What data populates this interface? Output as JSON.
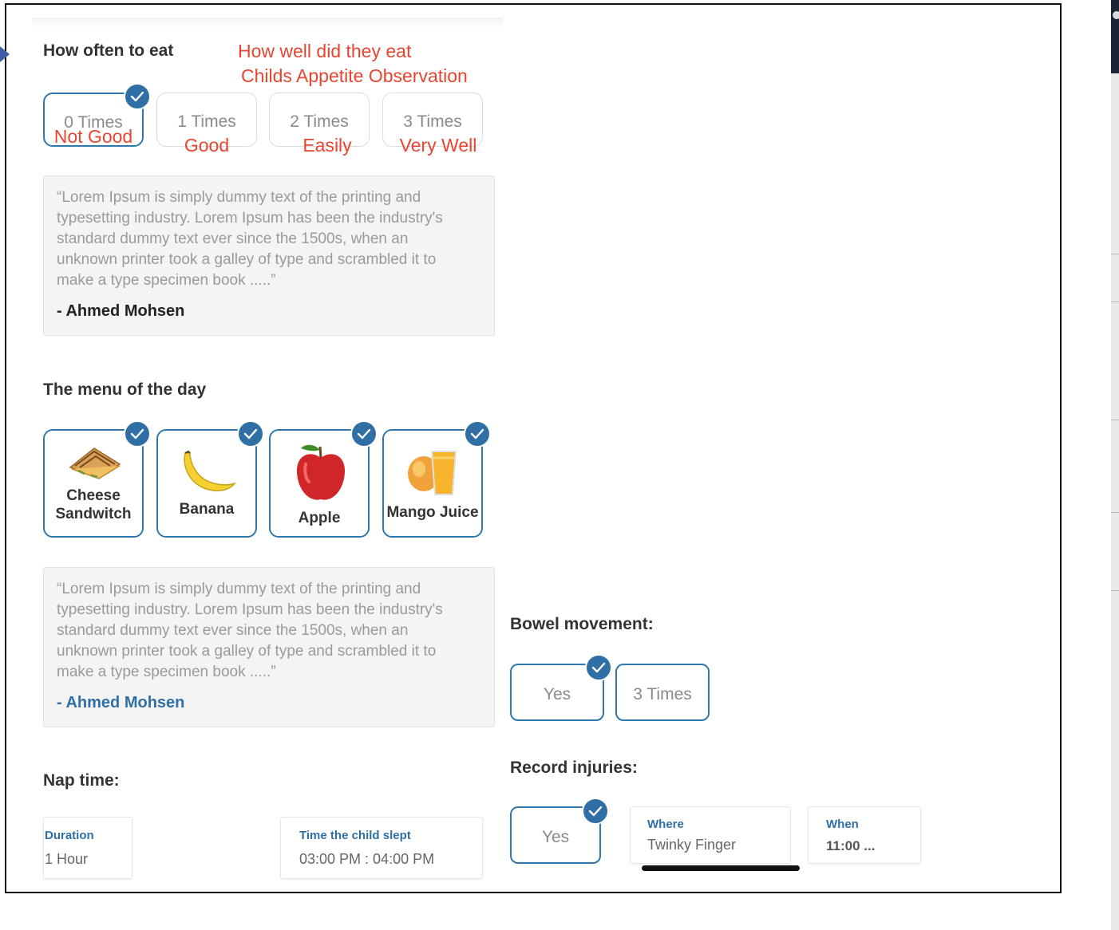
{
  "eat": {
    "title": "How often to eat",
    "annotation_line1": "How well did they eat",
    "annotation_line2": "Childs Appetite Observation",
    "options": [
      {
        "times": "0 Times",
        "rating": "Not Good",
        "selected": true
      },
      {
        "times": "1 Times",
        "rating": "Good",
        "selected": false
      },
      {
        "times": "2 Times",
        "rating": "Easily",
        "selected": false
      },
      {
        "times": "3 Times",
        "rating": "Very Well",
        "selected": false
      }
    ]
  },
  "note1": {
    "text": "“Lorem Ipsum is simply dummy text of the printing and typesetting industry. Lorem Ipsum has been the industry's standard dummy text ever since the 1500s, when an unknown printer took a galley of type and scrambled it to make a type specimen book .....”",
    "author": "- Ahmed Mohsen",
    "author_color": "#222222"
  },
  "menu": {
    "title": "The menu of the day",
    "items": [
      {
        "label_line1": "Cheese",
        "label_line2": "Sandwitch",
        "icon": "sandwich-icon"
      },
      {
        "label": "Banana",
        "icon": "banana-icon"
      },
      {
        "label": "Apple",
        "icon": "apple-icon"
      },
      {
        "label": "Mango Juice",
        "icon": "mango-juice-icon"
      }
    ]
  },
  "note2": {
    "text": "“Lorem Ipsum is simply dummy text of the printing and typesetting industry. Lorem Ipsum has been the industry's standard dummy text ever since the 1500s, when an unknown printer took a galley of type and scrambled it to make a type specimen book .....”",
    "author": "- Ahmed Mohsen",
    "author_color": "#2f6fa5"
  },
  "nap": {
    "title": "Nap time:",
    "duration_label": "Duration",
    "duration_value": "1 Hour",
    "slept_label": "Time the child slept",
    "slept_value": "03:00 PM : 04:00 PM"
  },
  "bowel": {
    "title": "Bowel movement:",
    "yes": "Yes",
    "times": "3 Times"
  },
  "injuries": {
    "title": "Record injuries:",
    "yes": "Yes",
    "where_label": "Where",
    "where_value": "Twinky Finger",
    "when_label": "When",
    "when_value": "11:00 ..."
  },
  "colors": {
    "accent": "#2f78ad",
    "check": "#2f6fa5",
    "annotation": "#e8442f"
  }
}
